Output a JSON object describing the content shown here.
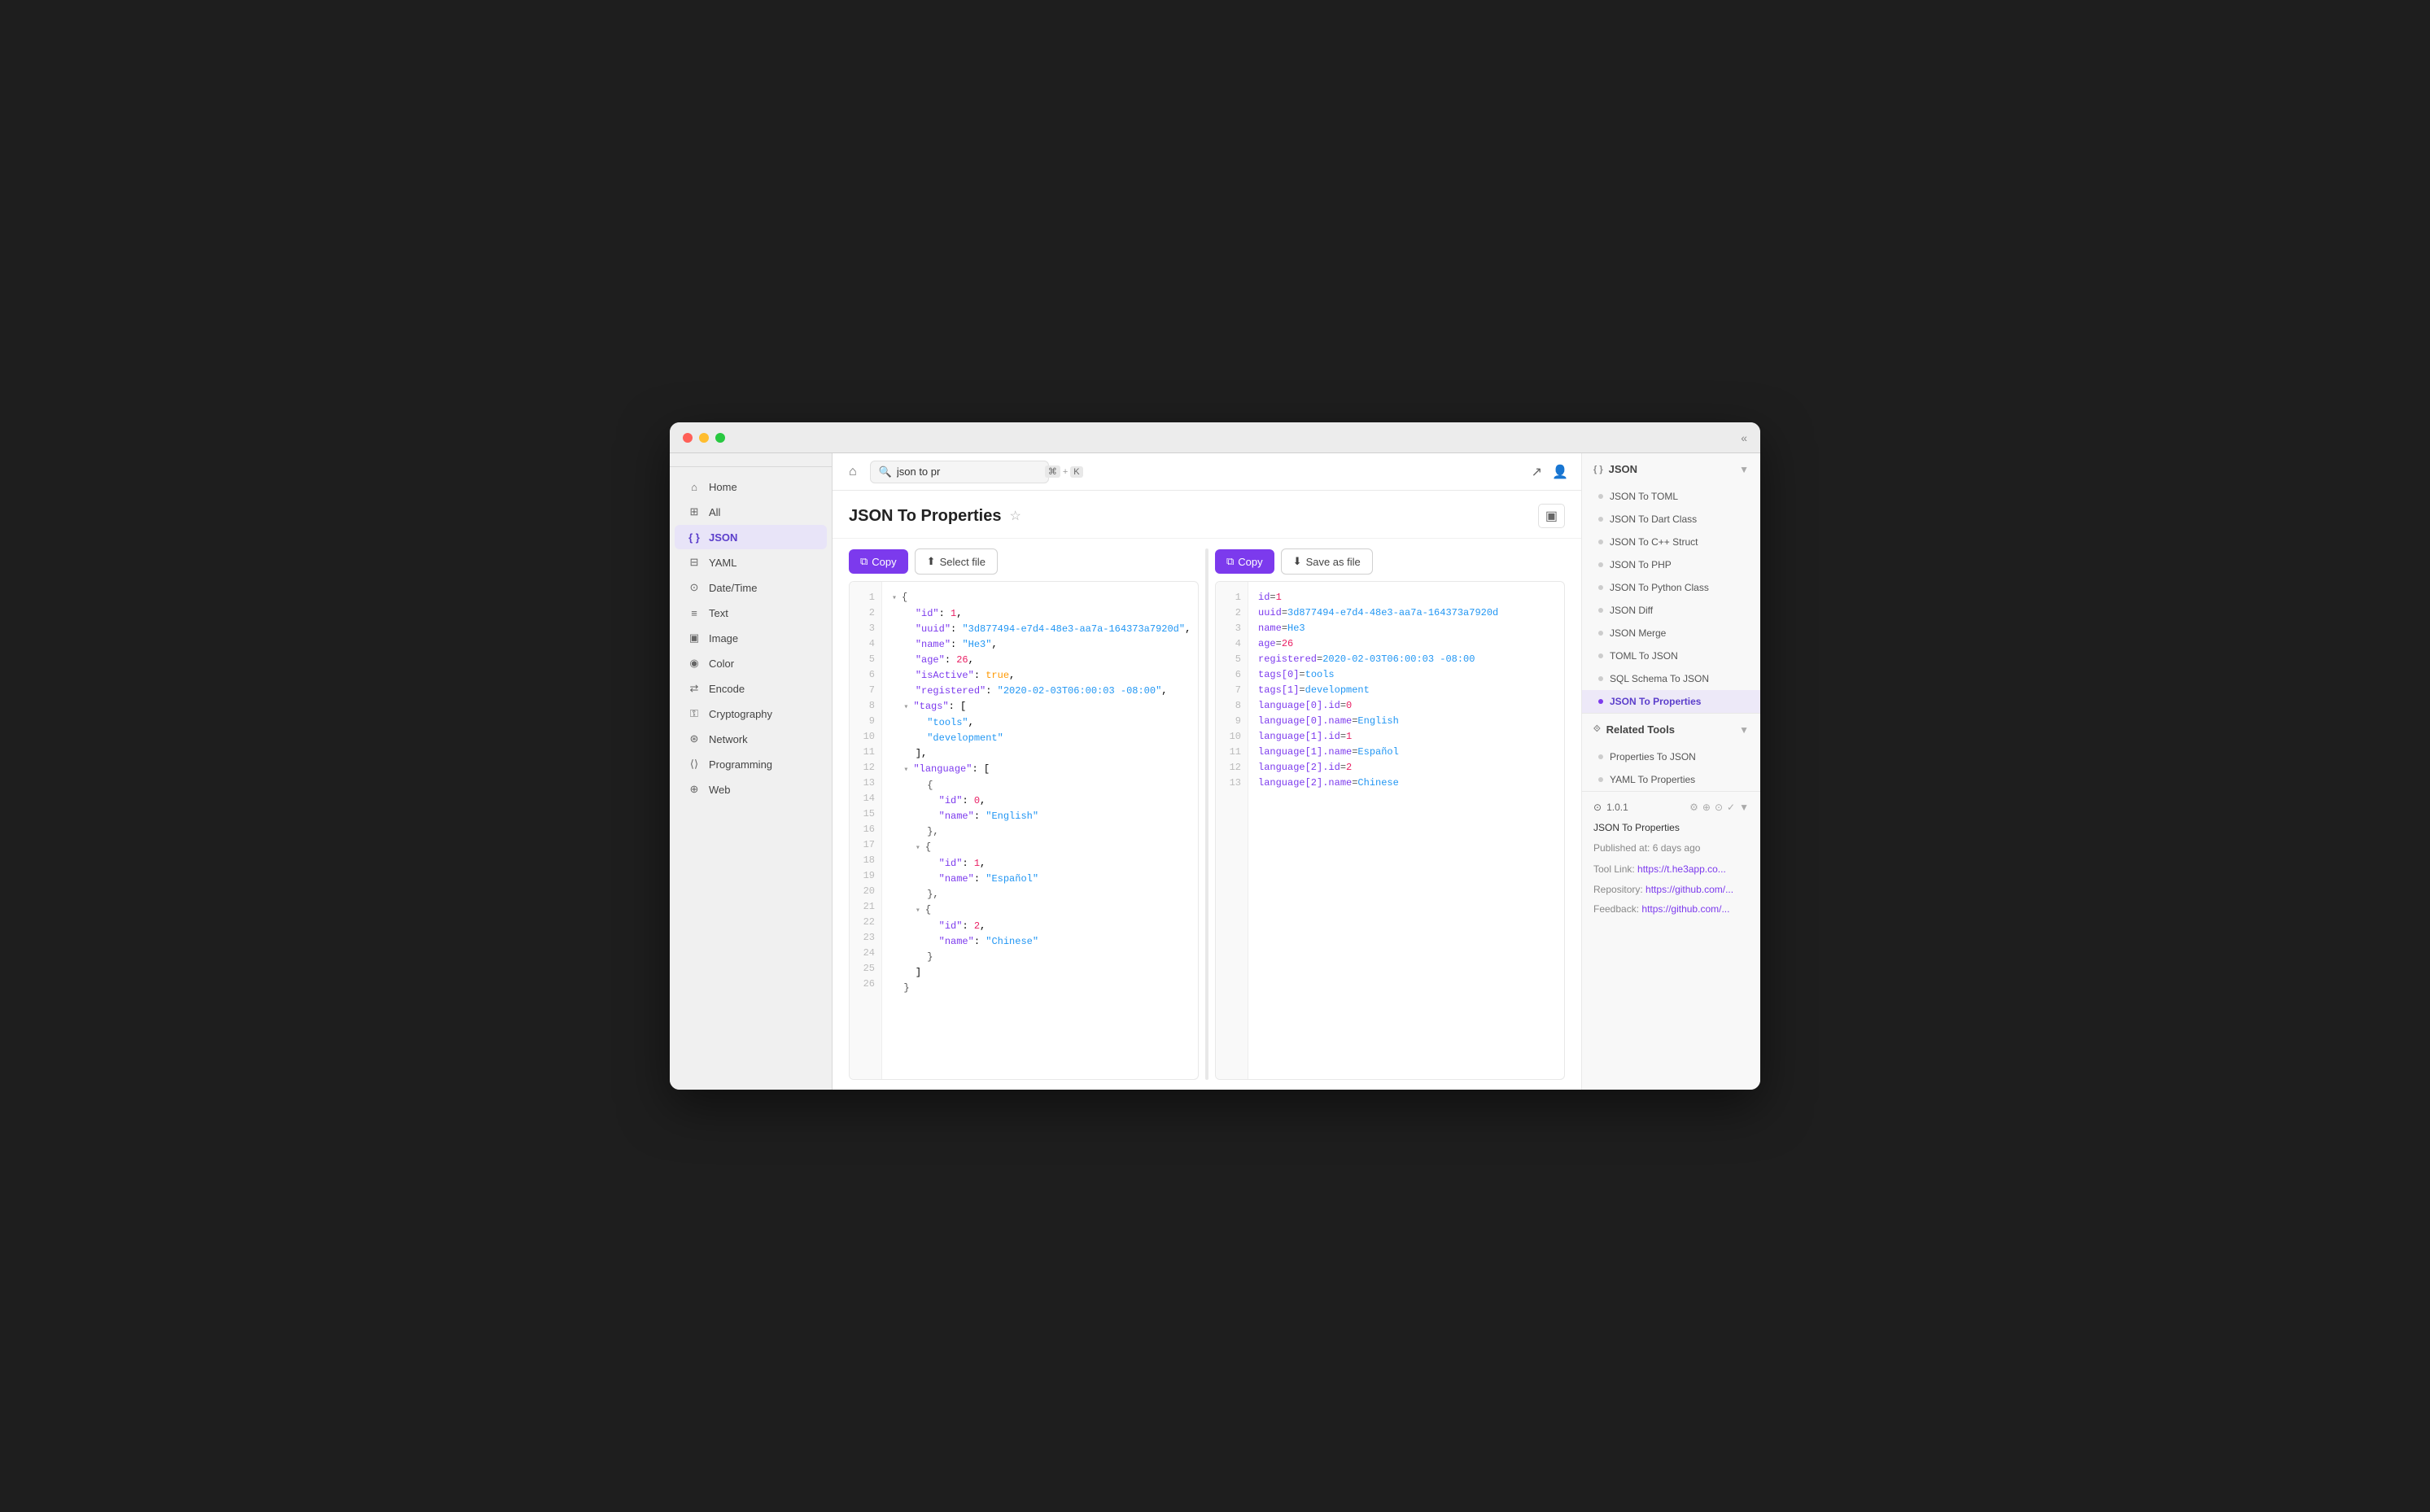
{
  "window": {
    "title": "JSON To Properties"
  },
  "titlebar": {
    "collapse_icon": "«"
  },
  "topbar": {
    "home_icon": "⌂",
    "search_placeholder": "json to pr",
    "shortcut_meta": "⌘",
    "shortcut_key": "K",
    "share_icon": "↗",
    "user_icon": "👤"
  },
  "page": {
    "title": "JSON To Properties",
    "star_icon": "☆",
    "layout_icon": "▣"
  },
  "sidebar": {
    "items": [
      {
        "id": "home",
        "label": "Home",
        "icon": "⌂",
        "active": false
      },
      {
        "id": "all",
        "label": "All",
        "icon": "⊞",
        "active": false
      },
      {
        "id": "json",
        "label": "JSON",
        "icon": "{ }",
        "active": true
      },
      {
        "id": "yaml",
        "label": "YAML",
        "icon": "⊟",
        "active": false
      },
      {
        "id": "datetime",
        "label": "Date/Time",
        "icon": "⊙",
        "active": false
      },
      {
        "id": "text",
        "label": "Text",
        "icon": "≡",
        "active": false
      },
      {
        "id": "image",
        "label": "Image",
        "icon": "▣",
        "active": false
      },
      {
        "id": "color",
        "label": "Color",
        "icon": "◉",
        "active": false
      },
      {
        "id": "encode",
        "label": "Encode",
        "icon": "⇄",
        "active": false
      },
      {
        "id": "cryptography",
        "label": "Cryptography",
        "icon": "⚿",
        "active": false
      },
      {
        "id": "network",
        "label": "Network",
        "icon": "⊛",
        "active": false
      },
      {
        "id": "programming",
        "label": "Programming",
        "icon": "⟨⟩",
        "active": false
      },
      {
        "id": "web",
        "label": "Web",
        "icon": "⊕",
        "active": false
      }
    ]
  },
  "left_panel": {
    "copy_btn": "Copy",
    "select_file_btn": "Select file",
    "copy_icon": "⧉",
    "select_icon": "⬆",
    "code_lines": [
      {
        "num": 1,
        "indent": 0,
        "has_chevron": true,
        "content_html": "<span class=\"json-brace\">{</span>"
      },
      {
        "num": 2,
        "indent": 1,
        "content_html": "<span class=\"json-key\">\"id\"</span><span>: </span><span class=\"json-number\">1</span><span>,</span>"
      },
      {
        "num": 3,
        "indent": 1,
        "content_html": "<span class=\"json-key\">\"uuid\"</span><span>: </span><span class=\"json-string\">\"3d877494-e7d4-48e3-aa7a-164373a7920d\"</span><span>,</span>"
      },
      {
        "num": 4,
        "indent": 1,
        "content_html": "<span class=\"json-key\">\"name\"</span><span>: </span><span class=\"json-string\">\"He3\"</span><span>,</span>"
      },
      {
        "num": 5,
        "indent": 1,
        "content_html": "<span class=\"json-key\">\"age\"</span><span>: </span><span class=\"json-number\">26</span><span>,</span>"
      },
      {
        "num": 6,
        "indent": 1,
        "content_html": "<span class=\"json-key\">\"isActive\"</span><span>: </span><span class=\"json-bool\">true</span><span>,</span>"
      },
      {
        "num": 7,
        "indent": 1,
        "content_html": "<span class=\"json-key\">\"registered\"</span><span>: </span><span class=\"json-string\">\"2020-02-03T06:00:03 -08:00\"</span><span>,</span>"
      },
      {
        "num": 8,
        "indent": 1,
        "has_chevron": true,
        "content_html": "<span class=\"json-key\">\"tags\"</span><span>: [</span>"
      },
      {
        "num": 9,
        "indent": 2,
        "content_html": "<span class=\"json-string\">\"tools\"</span><span>,</span>"
      },
      {
        "num": 10,
        "indent": 2,
        "content_html": "<span class=\"json-string\">\"development\"</span>"
      },
      {
        "num": 11,
        "indent": 1,
        "content_html": "<span>],</span>"
      },
      {
        "num": 12,
        "indent": 1,
        "has_chevron": true,
        "content_html": "<span class=\"json-key\">\"language\"</span><span>: [</span>"
      },
      {
        "num": 13,
        "indent": 2,
        "content_html": "<span class=\"json-brace\">{</span>"
      },
      {
        "num": 14,
        "indent": 3,
        "content_html": "<span class=\"json-key\">\"id\"</span><span>: </span><span class=\"json-number\">0</span><span>,</span>"
      },
      {
        "num": 15,
        "indent": 3,
        "content_html": "<span class=\"json-key\">\"name\"</span><span>: </span><span class=\"json-string\">\"English\"</span>"
      },
      {
        "num": 16,
        "indent": 2,
        "content_html": "<span class=\"json-brace\">},</span>"
      },
      {
        "num": 17,
        "indent": 2,
        "has_chevron": true,
        "content_html": "<span class=\"json-brace\">{</span>"
      },
      {
        "num": 18,
        "indent": 3,
        "content_html": "<span class=\"json-key\">\"id\"</span><span>: </span><span class=\"json-number\">1</span><span>,</span>"
      },
      {
        "num": 19,
        "indent": 3,
        "content_html": "<span class=\"json-key\">\"name\"</span><span>: </span><span class=\"json-string\">\"Español\"</span>"
      },
      {
        "num": 20,
        "indent": 2,
        "content_html": "<span class=\"json-brace\">},</span>"
      },
      {
        "num": 21,
        "indent": 2,
        "has_chevron": true,
        "content_html": "<span class=\"json-brace\">{</span>"
      },
      {
        "num": 22,
        "indent": 3,
        "content_html": "<span class=\"json-key\">\"id\"</span><span>: </span><span class=\"json-number\">2</span><span>,</span>"
      },
      {
        "num": 23,
        "indent": 3,
        "content_html": "<span class=\"json-key\">\"name\"</span><span>: </span><span class=\"json-string\">\"Chinese\"</span>"
      },
      {
        "num": 24,
        "indent": 2,
        "content_html": "<span class=\"json-brace\">}</span>"
      },
      {
        "num": 25,
        "indent": 1,
        "content_html": "<span>]</span>"
      },
      {
        "num": 26,
        "indent": 0,
        "content_html": "<span class=\"json-brace\">}</span>"
      }
    ]
  },
  "right_panel": {
    "copy_btn": "Copy",
    "save_btn": "Save as file",
    "copy_icon": "⧉",
    "save_icon": "⬇",
    "props_lines": [
      {
        "num": 1,
        "content": "id=1",
        "key": "id",
        "val": "1",
        "val_type": "num"
      },
      {
        "num": 2,
        "content": "uuid=3d877494-e7d4-48e3-aa7a-164373a7920d",
        "key": "uuid",
        "val": "3d877494-e7d4-48e3-aa7a-164373a7920d",
        "val_type": "str"
      },
      {
        "num": 3,
        "content": "name=He3",
        "key": "name",
        "val": "He3",
        "val_type": "str"
      },
      {
        "num": 4,
        "content": "age=26",
        "key": "age",
        "val": "26",
        "val_type": "num"
      },
      {
        "num": 5,
        "content": "registered=2020-02-03T06:00:03 -08:00",
        "key": "registered",
        "val": "2020-02-03T06:00:03 -08:00",
        "val_type": "str"
      },
      {
        "num": 6,
        "content": "tags[0]=tools",
        "key": "tags[0]",
        "val": "tools",
        "val_type": "str"
      },
      {
        "num": 7,
        "content": "tags[1]=development",
        "key": "tags[1]",
        "val": "development",
        "val_type": "str"
      },
      {
        "num": 8,
        "content": "language[0].id=0",
        "key": "language[0].id",
        "val": "0",
        "val_type": "num"
      },
      {
        "num": 9,
        "content": "language[0].name=English",
        "key": "language[0].name",
        "val": "English",
        "val_type": "str"
      },
      {
        "num": 10,
        "content": "language[1].id=1",
        "key": "language[1].id",
        "val": "1",
        "val_type": "num"
      },
      {
        "num": 11,
        "content": "language[1].name=Español",
        "key": "language[1].name",
        "val": "Español",
        "val_type": "str"
      },
      {
        "num": 12,
        "content": "language[2].id=2",
        "key": "language[2].id",
        "val": "2",
        "val_type": "num"
      },
      {
        "num": 13,
        "content": "language[2].name=Chinese",
        "key": "language[2].name",
        "val": "Chinese",
        "val_type": "str"
      }
    ]
  },
  "right_sidebar": {
    "json_section": {
      "title": "JSON",
      "items": [
        {
          "id": "json-to-toml",
          "label": "JSON To TOML",
          "active": false
        },
        {
          "id": "json-to-dart-class",
          "label": "JSON To Dart Class",
          "active": false
        },
        {
          "id": "json-to-cpp-struct",
          "label": "JSON To C++ Struct",
          "active": false
        },
        {
          "id": "json-to-php",
          "label": "JSON To PHP",
          "active": false
        },
        {
          "id": "json-to-python-class",
          "label": "JSON To Python Class",
          "active": false
        },
        {
          "id": "json-diff",
          "label": "JSON Diff",
          "active": false
        },
        {
          "id": "json-merge",
          "label": "JSON Merge",
          "active": false
        },
        {
          "id": "toml-to-json",
          "label": "TOML To JSON",
          "active": false
        },
        {
          "id": "sql-schema-to-json",
          "label": "SQL Schema To JSON",
          "active": false
        },
        {
          "id": "json-to-properties",
          "label": "JSON To Properties",
          "active": true
        }
      ]
    },
    "related_section": {
      "title": "Related Tools",
      "items": [
        {
          "id": "properties-to-json",
          "label": "Properties To JSON",
          "active": false
        },
        {
          "id": "yaml-to-properties",
          "label": "YAML To Properties",
          "active": false
        }
      ]
    },
    "version": {
      "label": "1.0.1",
      "tool_name": "JSON To Properties",
      "published": "Published at: 6 days ago",
      "tool_link_label": "Tool Link:",
      "tool_link_text": "https://t.he3app.co...",
      "repo_label": "Repository:",
      "repo_link_text": "https://github.com/...",
      "feedback_label": "Feedback:",
      "feedback_link_text": "https://github.com/..."
    }
  }
}
